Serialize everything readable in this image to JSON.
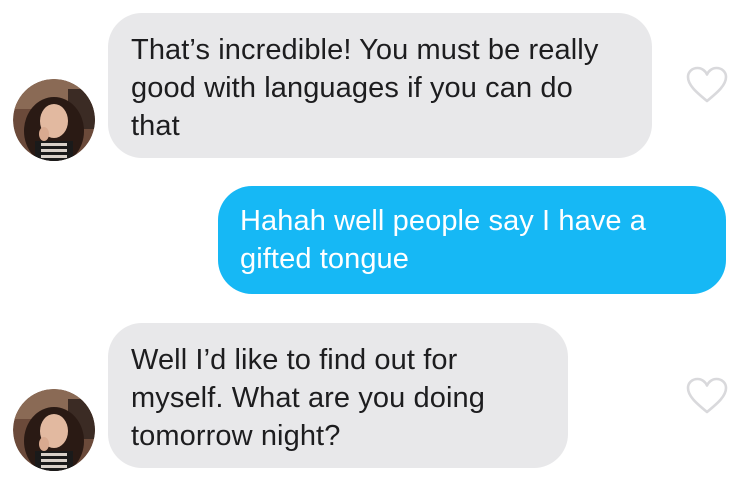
{
  "conversation": {
    "messages": [
      {
        "direction": "incoming",
        "text": "That’s incredible! You must be really good with languages if you can do that",
        "icons": {
          "avatar": "profile-photo",
          "like": "heart-outline-icon"
        }
      },
      {
        "direction": "outgoing",
        "text": "Hahah well people say I have a gifted tongue"
      },
      {
        "direction": "incoming",
        "text": "Well I’d like to find out for myself. What are you doing tomorrow night?",
        "icons": {
          "avatar": "profile-photo",
          "like": "heart-outline-icon"
        }
      }
    ]
  },
  "colors": {
    "incoming_bubble": "#e8e8ea",
    "outgoing_bubble": "#16b8f5",
    "incoming_text": "#1d1d1f",
    "outgoing_text": "#ffffff",
    "heart_stroke": "#d9d9dc"
  }
}
